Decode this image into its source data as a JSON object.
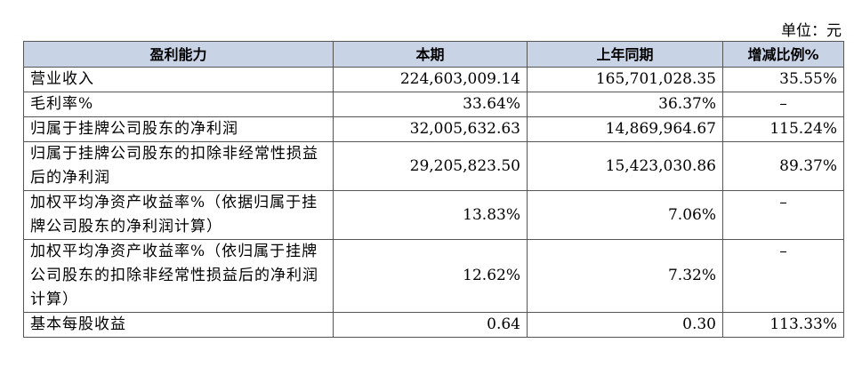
{
  "unit_label": "单位：元",
  "headers": [
    "盈利能力",
    "本期",
    "上年同期",
    "增减比例%"
  ],
  "rows": [
    {
      "label": "营业收入",
      "current": "224,603,009.14",
      "previous": "165,701,028.35",
      "change": "35.55%"
    },
    {
      "label": "毛利率%",
      "current": "33.64%",
      "previous": "36.37%",
      "change": "–"
    },
    {
      "label": "归属于挂牌公司股东的净利润",
      "current": "32,005,632.63",
      "previous": "14,869,964.67",
      "change": "115.24%"
    },
    {
      "label": "归属于挂牌公司股东的扣除非经常性损益后的净利润",
      "current": "29,205,823.50",
      "previous": "15,423,030.86",
      "change": "89.37%"
    },
    {
      "label": "加权平均净资产收益率%（依据归属于挂牌公司股东的净利润计算）",
      "current": "13.83%",
      "previous": "7.06%",
      "change": "–"
    },
    {
      "label": "加权平均净资产收益率%（依归属于挂牌公司股东的扣除非经常性损益后的净利润计算）",
      "current": "12.62%",
      "previous": "7.32%",
      "change": "–"
    },
    {
      "label": "基本每股收益",
      "current": "0.64",
      "previous": "0.30",
      "change": "113.33%"
    }
  ]
}
